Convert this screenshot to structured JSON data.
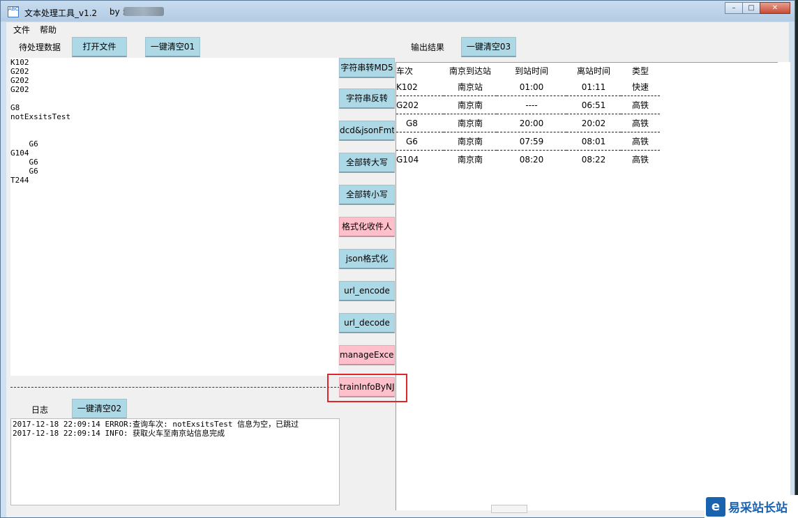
{
  "window": {
    "title": "文本处理工具_v1.2",
    "by_label": "by :",
    "icon_text": "ABC",
    "min_symbol": "–",
    "max_symbol": "□",
    "close_symbol": "✕"
  },
  "menu": {
    "file": "文件",
    "help": "帮助"
  },
  "input_section": {
    "label": "待处理数据",
    "open_button": "打开文件",
    "clear_button": "一键清空01",
    "text": "K102\nG202\nG202\nG202\n\nG8\nnotExsitsTest\n\n\n    G6\nG104\n    G6\n    G6\nT244"
  },
  "log_section": {
    "label": "日志",
    "clear_button": "一键清空02",
    "text": "2017-12-18 22:09:14 ERROR:查询车次: notExsitsTest 信息为空，已跳过\n2017-12-18 22:09:14 INFO: 获取火车至南京站信息完成"
  },
  "output_section": {
    "label": "输出结果",
    "clear_button": "一键清空03",
    "headers": [
      "车次",
      "南京到达站",
      "到站时间",
      "离站时间",
      "类型"
    ],
    "rows": [
      [
        "K102",
        "南京站",
        "01:00",
        "01:11",
        "快速"
      ],
      [
        "G202",
        "南京南",
        "----",
        "06:51",
        "高铁"
      ],
      [
        "G8",
        "南京南",
        "20:00",
        "20:02",
        "高铁"
      ],
      [
        "G6",
        "南京南",
        "07:59",
        "08:01",
        "高铁"
      ],
      [
        "G104",
        "南京南",
        "08:20",
        "08:22",
        "高铁"
      ]
    ]
  },
  "tools": [
    {
      "label": "字符串转MD5",
      "style": "blue"
    },
    {
      "label": "字符串反转",
      "style": "blue"
    },
    {
      "label": "dcd&jsonFmt",
      "style": "blue"
    },
    {
      "label": "全部转大写",
      "style": "blue"
    },
    {
      "label": "全部转小写",
      "style": "blue"
    },
    {
      "label": "格式化收件人",
      "style": "pink"
    },
    {
      "label": "json格式化",
      "style": "blue"
    },
    {
      "label": "url_encode",
      "style": "blue"
    },
    {
      "label": "url_decode",
      "style": "blue"
    },
    {
      "label": "manageExcel",
      "style": "pink"
    },
    {
      "label": "trainInfoByNJ",
      "style": "pink"
    }
  ],
  "watermark": {
    "icon": "e",
    "text": "易采站长站"
  },
  "colors": {
    "button_blue": "#add8e6",
    "button_pink": "#ffc0cb",
    "highlight_red": "#e0262b"
  }
}
